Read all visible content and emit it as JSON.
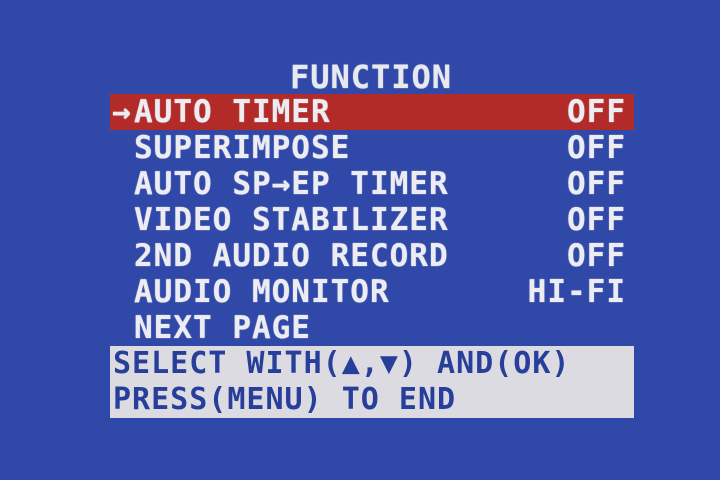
{
  "screen": {
    "title": "FUNCTION",
    "selected_marker": "→",
    "items": [
      {
        "label": "AUTO TIMER",
        "value": "OFF"
      },
      {
        "label": "SUPERIMPOSE",
        "value": "OFF"
      },
      {
        "label": "AUTO SP→EP TIMER",
        "value": "OFF"
      },
      {
        "label": "VIDEO STABILIZER",
        "value": "OFF"
      },
      {
        "label": "2ND AUDIO RECORD",
        "value": "OFF"
      },
      {
        "label": "AUDIO MONITOR",
        "value": "HI-FI"
      },
      {
        "label": "NEXT PAGE",
        "value": ""
      }
    ],
    "help": {
      "line1": "SELECT WITH(▲,▼) AND(OK)",
      "line2": "PRESS(MENU) TO END"
    }
  },
  "colors": {
    "background": "#3049a8",
    "selection": "#b32b28",
    "text": "#ececf2",
    "help_background": "#dcdbe2",
    "help_text": "#273f9b"
  }
}
